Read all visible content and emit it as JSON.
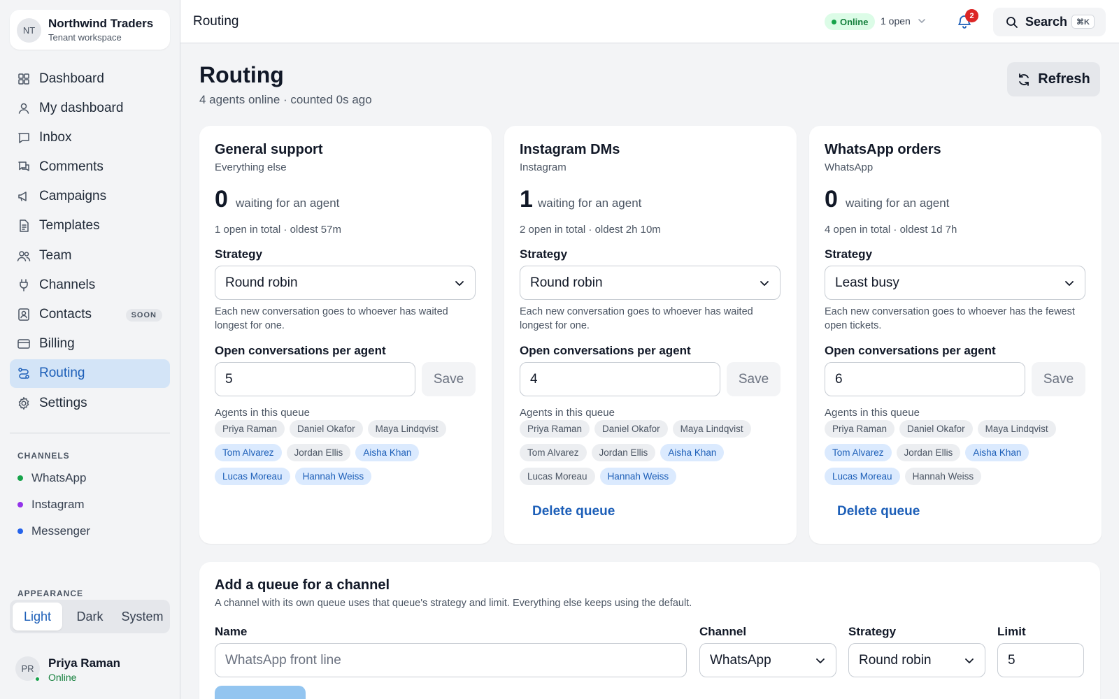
{
  "workspace": {
    "initials": "NT",
    "name": "Northwind Traders",
    "subtitle": "Tenant workspace"
  },
  "nav": [
    {
      "label": "Dashboard",
      "icon": "grid-icon"
    },
    {
      "label": "My dashboard",
      "icon": "user-icon"
    },
    {
      "label": "Inbox",
      "icon": "chat-icon"
    },
    {
      "label": "Comments",
      "icon": "comments-icon"
    },
    {
      "label": "Campaigns",
      "icon": "megaphone-icon"
    },
    {
      "label": "Templates",
      "icon": "document-icon"
    },
    {
      "label": "Team",
      "icon": "team-icon"
    },
    {
      "label": "Channels",
      "icon": "plug-icon"
    },
    {
      "label": "Contacts",
      "icon": "contact-card-icon",
      "badge": "SOON"
    },
    {
      "label": "Billing",
      "icon": "credit-card-icon"
    },
    {
      "label": "Routing",
      "icon": "routing-icon",
      "active": true
    },
    {
      "label": "Settings",
      "icon": "gear-icon"
    }
  ],
  "channels_section": {
    "heading": "CHANNELS",
    "items": [
      {
        "label": "WhatsApp",
        "color": "#16a34a"
      },
      {
        "label": "Instagram",
        "color": "#9333ea"
      },
      {
        "label": "Messenger",
        "color": "#2563eb"
      }
    ]
  },
  "appearance": {
    "heading": "APPEARANCE",
    "options": [
      "Light",
      "Dark",
      "System"
    ],
    "selected": "Light"
  },
  "user": {
    "initials": "PR",
    "name": "Priya Raman",
    "status": "Online"
  },
  "topbar": {
    "title": "Routing",
    "status": "Online",
    "open_count": "1 open",
    "notifications": "2",
    "search_label": "Search",
    "search_shortcut": "⌘K"
  },
  "page": {
    "title": "Routing",
    "subtitle": "4 agents online · counted 0s ago",
    "refresh_label": "Refresh"
  },
  "labels": {
    "waiting": "waiting for an agent",
    "strategy": "Strategy",
    "per_agent": "Open conversations per agent",
    "save": "Save",
    "agents": "Agents in this queue",
    "delete": "Delete queue"
  },
  "queues": [
    {
      "name": "General support",
      "channel": "Everything else",
      "waiting": "0",
      "open_summary": "1 open in total · oldest 57m",
      "strategy": "Round robin",
      "strategy_help": "Each new conversation goes to whoever has waited longest for one.",
      "limit": "5",
      "deletable": false,
      "agents": [
        {
          "name": "Priya Raman",
          "member": false
        },
        {
          "name": "Daniel Okafor",
          "member": false
        },
        {
          "name": "Maya Lindqvist",
          "member": false
        },
        {
          "name": "Tom Alvarez",
          "member": true
        },
        {
          "name": "Jordan Ellis",
          "member": false
        },
        {
          "name": "Aisha Khan",
          "member": true
        },
        {
          "name": "Lucas Moreau",
          "member": true
        },
        {
          "name": "Hannah Weiss",
          "member": true
        }
      ]
    },
    {
      "name": "Instagram DMs",
      "channel": "Instagram",
      "waiting": "1",
      "open_summary": "2 open in total · oldest 2h 10m",
      "strategy": "Round robin",
      "strategy_help": "Each new conversation goes to whoever has waited longest for one.",
      "limit": "4",
      "deletable": true,
      "agents": [
        {
          "name": "Priya Raman",
          "member": false
        },
        {
          "name": "Daniel Okafor",
          "member": false
        },
        {
          "name": "Maya Lindqvist",
          "member": false
        },
        {
          "name": "Tom Alvarez",
          "member": false
        },
        {
          "name": "Jordan Ellis",
          "member": false
        },
        {
          "name": "Aisha Khan",
          "member": true
        },
        {
          "name": "Lucas Moreau",
          "member": false
        },
        {
          "name": "Hannah Weiss",
          "member": true
        }
      ]
    },
    {
      "name": "WhatsApp orders",
      "channel": "WhatsApp",
      "waiting": "0",
      "open_summary": "4 open in total · oldest 1d 7h",
      "strategy": "Least busy",
      "strategy_help": "Each new conversation goes to whoever has the fewest open tickets.",
      "limit": "6",
      "deletable": true,
      "agents": [
        {
          "name": "Priya Raman",
          "member": false
        },
        {
          "name": "Daniel Okafor",
          "member": false
        },
        {
          "name": "Maya Lindqvist",
          "member": false
        },
        {
          "name": "Tom Alvarez",
          "member": true
        },
        {
          "name": "Jordan Ellis",
          "member": false
        },
        {
          "name": "Aisha Khan",
          "member": true
        },
        {
          "name": "Lucas Moreau",
          "member": true
        },
        {
          "name": "Hannah Weiss",
          "member": false
        }
      ]
    }
  ],
  "add_queue": {
    "title": "Add a queue for a channel",
    "description": "A channel with its own queue uses that queue's strategy and limit. Everything else keeps using the default.",
    "name_label": "Name",
    "name_placeholder": "WhatsApp front line",
    "channel_label": "Channel",
    "channel_value": "WhatsApp",
    "strategy_label": "Strategy",
    "strategy_value": "Round robin",
    "limit_label": "Limit",
    "limit_value": "5"
  },
  "colors": {
    "accent": "#1d5fb8",
    "online": "#16a34a",
    "badge": "#dc2626"
  }
}
